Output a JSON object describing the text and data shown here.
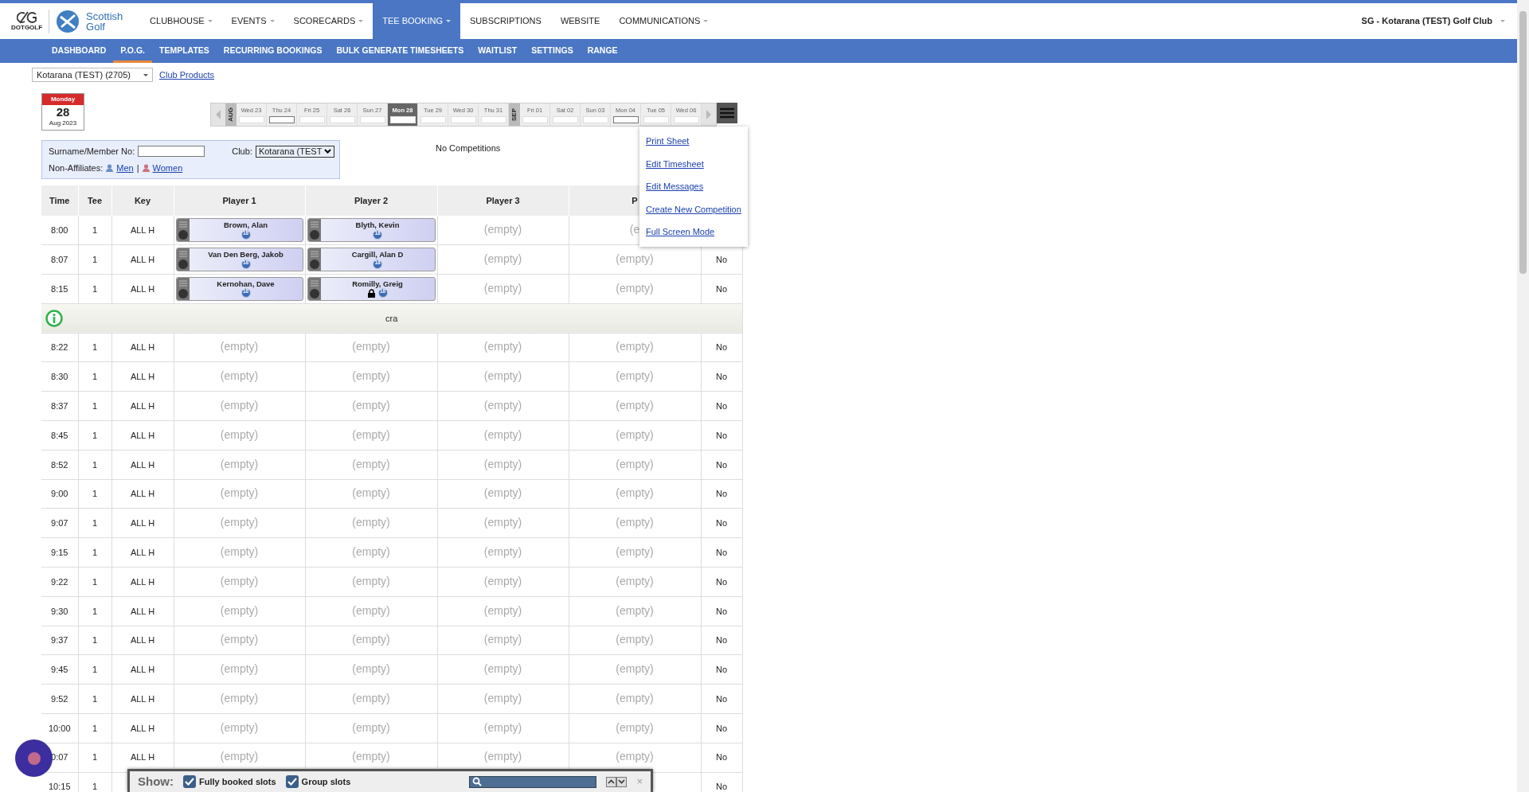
{
  "brand": {
    "dotgolf": "DOTGOLF",
    "scottish": "Scottish Golf"
  },
  "nav": [
    {
      "label": "CLUBHOUSE",
      "dropdown": true,
      "selected": false
    },
    {
      "label": "EVENTS",
      "dropdown": true,
      "selected": false
    },
    {
      "label": "SCORECARDS",
      "dropdown": true,
      "selected": false
    },
    {
      "label": "TEE BOOKING",
      "dropdown": true,
      "selected": true
    },
    {
      "label": "SUBSCRIPTIONS",
      "dropdown": false,
      "selected": false
    },
    {
      "label": "WEBSITE",
      "dropdown": false,
      "selected": false
    },
    {
      "label": "COMMUNICATIONS",
      "dropdown": true,
      "selected": false
    }
  ],
  "club_menu": "SG - Kotarana (TEST) Golf Club",
  "subnav": [
    {
      "label": "DASHBOARD",
      "selected": false
    },
    {
      "label": "P.O.G.",
      "selected": true
    },
    {
      "label": "TEMPLATES",
      "selected": false
    },
    {
      "label": "RECURRING BOOKINGS",
      "selected": false
    },
    {
      "label": "BULK GENERATE TIMESHEETS",
      "selected": false
    },
    {
      "label": "WAITLIST",
      "selected": false
    },
    {
      "label": "SETTINGS",
      "selected": false
    },
    {
      "label": "RANGE",
      "selected": false
    }
  ],
  "course_select": "Kotarana (TEST) (2705)",
  "club_products": "Club Products",
  "calendar": {
    "weekday": "Monday",
    "day": "28",
    "month": "Aug 2023"
  },
  "date_strip": [
    {
      "kind": "month",
      "label": "AUG"
    },
    {
      "kind": "day",
      "label": "Wed 23",
      "selected": false,
      "marked": false
    },
    {
      "kind": "day",
      "label": "Thu 24",
      "selected": false,
      "marked": true
    },
    {
      "kind": "day",
      "label": "Fri 25",
      "selected": false,
      "marked": false
    },
    {
      "kind": "day",
      "label": "Sat 26",
      "selected": false,
      "marked": false
    },
    {
      "kind": "day",
      "label": "Sun 27",
      "selected": false,
      "marked": false
    },
    {
      "kind": "day",
      "label": "Mon 28",
      "selected": true,
      "marked": false
    },
    {
      "kind": "day",
      "label": "Tue 29",
      "selected": false,
      "marked": false
    },
    {
      "kind": "day",
      "label": "Wed 30",
      "selected": false,
      "marked": false
    },
    {
      "kind": "day",
      "label": "Thu 31",
      "selected": false,
      "marked": false
    },
    {
      "kind": "month",
      "label": "SEP"
    },
    {
      "kind": "day",
      "label": "Fri 01",
      "selected": false,
      "marked": false
    },
    {
      "kind": "day",
      "label": "Sat 02",
      "selected": false,
      "marked": false
    },
    {
      "kind": "day",
      "label": "Sun 03",
      "selected": false,
      "marked": false
    },
    {
      "kind": "day",
      "label": "Mon 04",
      "selected": false,
      "marked": true
    },
    {
      "kind": "day",
      "label": "Tue 05",
      "selected": false,
      "marked": false
    },
    {
      "kind": "day",
      "label": "Wed 06",
      "selected": false,
      "marked": false
    }
  ],
  "filter": {
    "surname_label": "Surname/Member No:",
    "club_label": "Club:",
    "club_value": "Kotarana (TEST",
    "non_affiliates": "Non-Affiliates:",
    "men": "Men",
    "separator": "|",
    "women": "Women"
  },
  "competitions": "No Competitions",
  "menu": [
    "Print Sheet",
    "Edit Timesheet",
    "Edit Messages",
    "Create New Competition",
    "Full Screen Mode"
  ],
  "table": {
    "columns": [
      "Time",
      "Tee",
      "Key",
      "Player 1",
      "Player 2",
      "Player 3",
      "P"
    ],
    "rows": [
      {
        "kind": "slot",
        "time": "8:00",
        "tee": "1",
        "key": "ALL H",
        "players": [
          {
            "name": "Brown, Alan",
            "badge": "18",
            "locked": false
          },
          {
            "name": "Blyth, Kevin",
            "badge": "18",
            "locked": false
          },
          {
            "empty": "(empty)"
          },
          {
            "empty": "(e"
          }
        ]
      },
      {
        "kind": "slot",
        "time": "8:07",
        "tee": "1",
        "key": "ALL H",
        "players": [
          {
            "name": "Van Den Berg, Jakob",
            "badge": "18",
            "locked": false
          },
          {
            "name": "Cargill, Alan D",
            "badge": "18",
            "locked": false
          },
          {
            "empty": "(empty)"
          },
          {
            "empty": "(empty)"
          }
        ],
        "last": "No"
      },
      {
        "kind": "slot",
        "time": "8:15",
        "tee": "1",
        "key": "ALL H",
        "players": [
          {
            "name": "Kernohan, Dave",
            "badge": "18",
            "locked": false
          },
          {
            "name": "Romilly, Greig",
            "badge": "18",
            "locked": true
          },
          {
            "empty": "(empty)"
          },
          {
            "empty": "(empty)"
          }
        ],
        "last": "No"
      },
      {
        "kind": "notice",
        "text": "cra"
      },
      {
        "kind": "slot",
        "time": "8:22",
        "tee": "1",
        "key": "ALL H",
        "players": [
          {
            "empty": "(empty)"
          },
          {
            "empty": "(empty)"
          },
          {
            "empty": "(empty)"
          },
          {
            "empty": "(empty)"
          }
        ],
        "last": "No"
      },
      {
        "kind": "slot",
        "time": "8:30",
        "tee": "1",
        "key": "ALL H",
        "players": [
          {
            "empty": "(empty)"
          },
          {
            "empty": "(empty)"
          },
          {
            "empty": "(empty)"
          },
          {
            "empty": "(empty)"
          }
        ],
        "last": "No"
      },
      {
        "kind": "slot",
        "time": "8:37",
        "tee": "1",
        "key": "ALL H",
        "players": [
          {
            "empty": "(empty)"
          },
          {
            "empty": "(empty)"
          },
          {
            "empty": "(empty)"
          },
          {
            "empty": "(empty)"
          }
        ],
        "last": "No"
      },
      {
        "kind": "slot",
        "time": "8:45",
        "tee": "1",
        "key": "ALL H",
        "players": [
          {
            "empty": "(empty)"
          },
          {
            "empty": "(empty)"
          },
          {
            "empty": "(empty)"
          },
          {
            "empty": "(empty)"
          }
        ],
        "last": "No"
      },
      {
        "kind": "slot",
        "time": "8:52",
        "tee": "1",
        "key": "ALL H",
        "players": [
          {
            "empty": "(empty)"
          },
          {
            "empty": "(empty)"
          },
          {
            "empty": "(empty)"
          },
          {
            "empty": "(empty)"
          }
        ],
        "last": "No"
      },
      {
        "kind": "slot",
        "time": "9:00",
        "tee": "1",
        "key": "ALL H",
        "players": [
          {
            "empty": "(empty)"
          },
          {
            "empty": "(empty)"
          },
          {
            "empty": "(empty)"
          },
          {
            "empty": "(empty)"
          }
        ],
        "last": "No"
      },
      {
        "kind": "slot",
        "time": "9:07",
        "tee": "1",
        "key": "ALL H",
        "players": [
          {
            "empty": "(empty)"
          },
          {
            "empty": "(empty)"
          },
          {
            "empty": "(empty)"
          },
          {
            "empty": "(empty)"
          }
        ],
        "last": "No"
      },
      {
        "kind": "slot",
        "time": "9:15",
        "tee": "1",
        "key": "ALL H",
        "players": [
          {
            "empty": "(empty)"
          },
          {
            "empty": "(empty)"
          },
          {
            "empty": "(empty)"
          },
          {
            "empty": "(empty)"
          }
        ],
        "last": "No"
      },
      {
        "kind": "slot",
        "time": "9:22",
        "tee": "1",
        "key": "ALL H",
        "players": [
          {
            "empty": "(empty)"
          },
          {
            "empty": "(empty)"
          },
          {
            "empty": "(empty)"
          },
          {
            "empty": "(empty)"
          }
        ],
        "last": "No"
      },
      {
        "kind": "slot",
        "time": "9:30",
        "tee": "1",
        "key": "ALL H",
        "players": [
          {
            "empty": "(empty)"
          },
          {
            "empty": "(empty)"
          },
          {
            "empty": "(empty)"
          },
          {
            "empty": "(empty)"
          }
        ],
        "last": "No"
      },
      {
        "kind": "slot",
        "time": "9:37",
        "tee": "1",
        "key": "ALL H",
        "players": [
          {
            "empty": "(empty)"
          },
          {
            "empty": "(empty)"
          },
          {
            "empty": "(empty)"
          },
          {
            "empty": "(empty)"
          }
        ],
        "last": "No"
      },
      {
        "kind": "slot",
        "time": "9:45",
        "tee": "1",
        "key": "ALL H",
        "players": [
          {
            "empty": "(empty)"
          },
          {
            "empty": "(empty)"
          },
          {
            "empty": "(empty)"
          },
          {
            "empty": "(empty)"
          }
        ],
        "last": "No"
      },
      {
        "kind": "slot",
        "time": "9:52",
        "tee": "1",
        "key": "ALL H",
        "players": [
          {
            "empty": "(empty)"
          },
          {
            "empty": "(empty)"
          },
          {
            "empty": "(empty)"
          },
          {
            "empty": "(empty)"
          }
        ],
        "last": "No"
      },
      {
        "kind": "slot",
        "time": "10:00",
        "tee": "1",
        "key": "ALL H",
        "players": [
          {
            "empty": "(empty)"
          },
          {
            "empty": "(empty)"
          },
          {
            "empty": "(empty)"
          },
          {
            "empty": "(empty)"
          }
        ],
        "last": "No"
      },
      {
        "kind": "slot",
        "time": "0:07",
        "tee": "1",
        "key": "ALL H",
        "players": [
          {
            "empty": "(empty)"
          },
          {
            "empty": "(empty)"
          },
          {
            "empty": "(empty)"
          },
          {
            "empty": "(empty)"
          }
        ],
        "last": "No"
      },
      {
        "kind": "slot",
        "time": "10:15",
        "tee": "1",
        "last": "No"
      }
    ]
  },
  "show_bar": {
    "label": "Show:",
    "options": [
      {
        "label": "Fully booked slots",
        "checked": true
      },
      {
        "label": "Group slots",
        "checked": true
      }
    ],
    "close": "×"
  }
}
